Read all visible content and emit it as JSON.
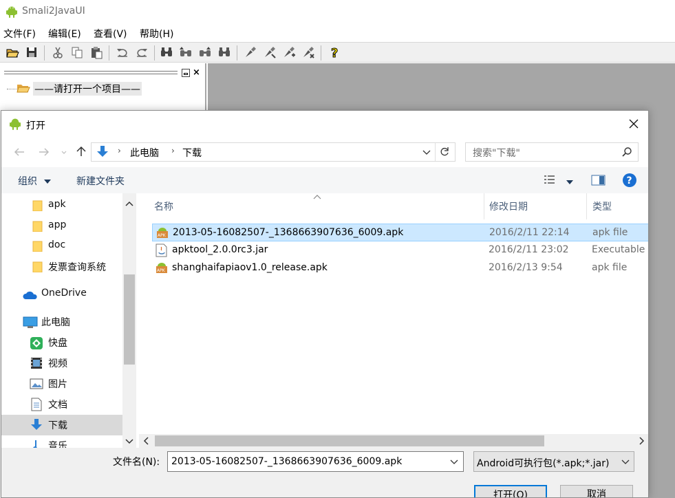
{
  "app": {
    "title": "Smali2JavaUI",
    "menu": [
      "文件(F)",
      "编辑(E)",
      "查看(V)",
      "帮助(H)"
    ],
    "tree_item": "——请打开一个项目——"
  },
  "dialog": {
    "title": "打开",
    "path": [
      "此电脑",
      "下载"
    ],
    "search_placeholder": "搜索\"下载\"",
    "organize_label": "组织",
    "new_folder_label": "新建文件夹",
    "nav_items": [
      {
        "label": "apk",
        "icon": "folder-icon"
      },
      {
        "label": "app",
        "icon": "folder-icon"
      },
      {
        "label": "doc",
        "icon": "folder-icon"
      },
      {
        "label": "发票查询系统",
        "icon": "folder-icon"
      },
      {
        "label": "OneDrive",
        "icon": "onedrive-icon"
      },
      {
        "label": "此电脑",
        "icon": "computer-icon"
      },
      {
        "label": "快盘",
        "icon": "kuaipan-icon"
      },
      {
        "label": "视频",
        "icon": "video-icon"
      },
      {
        "label": "图片",
        "icon": "pictures-icon"
      },
      {
        "label": "文档",
        "icon": "documents-icon"
      },
      {
        "label": "下载",
        "icon": "downloads-icon"
      },
      {
        "label": "音乐",
        "icon": "music-icon"
      }
    ],
    "columns": [
      "名称",
      "修改日期",
      "类型"
    ],
    "files": [
      {
        "name": "2013-05-16082507-_1368663907636_6009.apk",
        "date": "2016/2/11 22:14",
        "type": "apk file",
        "icon": "apk-icon"
      },
      {
        "name": "apktool_2.0.0rc3.jar",
        "date": "2016/2/11 23:02",
        "type": "Executable",
        "icon": "jar-icon"
      },
      {
        "name": "shanghaifapiaov1.0_release.apk",
        "date": "2016/2/13 9:54",
        "type": "apk file",
        "icon": "apk-icon"
      }
    ],
    "filename_label": "文件名(N):",
    "filename_value": "2013-05-16082507-_1368663907636_6009.apk",
    "filter_value": "Android可执行包(*.apk;*.jar)",
    "open_label": "打开(O)",
    "cancel_label": "取消"
  },
  "colors": {
    "selection": "#cce8ff",
    "selection_border": "#99d1ff",
    "workspace": "#a6a6a6",
    "accent": "#0078d7"
  }
}
